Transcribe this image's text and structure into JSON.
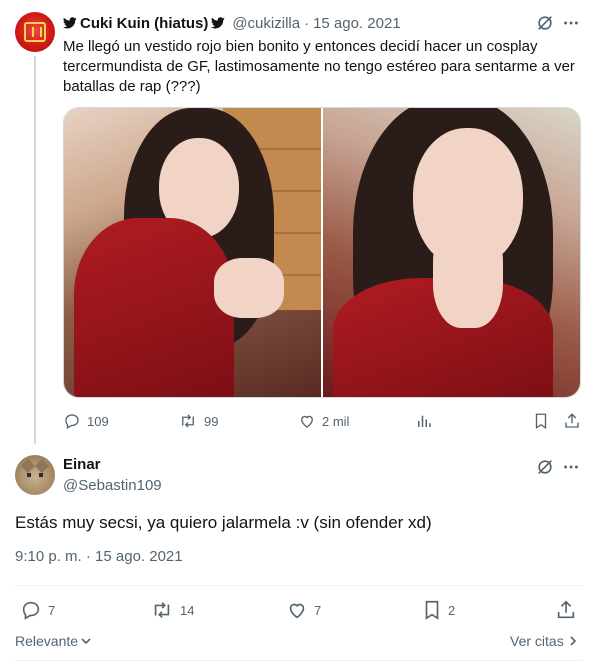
{
  "parent_tweet": {
    "author_name": "Cuki Kuin (hiatus)",
    "handle": "@cukizilla",
    "separator": "·",
    "date": "15 ago. 2021",
    "text": "Me llegó un vestido rojo bien bonito y entonces decidí hacer un cosplay tercermundista de GF, lastimosamente no tengo estéreo para sentarme a ver batallas de rap (???)",
    "stats": {
      "replies": "109",
      "retweets": "99",
      "likes": "2 mil"
    }
  },
  "reply_tweet": {
    "author_name": "Einar",
    "handle": "@Sebastin109",
    "text": "Estás muy secsi, ya quiero jalarmela :v (sin ofender xd)",
    "timestamp": "9:10 p. m. · 15 ago. 2021",
    "stats": {
      "replies": "7",
      "retweets": "14",
      "likes": "7",
      "bookmarks": "2"
    }
  },
  "footer": {
    "sort_label": "Relevante",
    "quotes_label": "Ver citas"
  },
  "icons": {
    "bird": "twitter-bird-icon",
    "grok": "grok-icon",
    "more": "more-icon",
    "reply": "reply-icon",
    "retweet": "retweet-icon",
    "like": "heart-icon",
    "views": "views-icon",
    "bookmark": "bookmark-icon",
    "share": "share-icon"
  },
  "colors": {
    "text": "#0f1419",
    "muted": "#536471",
    "divider": "#eff3f4"
  }
}
